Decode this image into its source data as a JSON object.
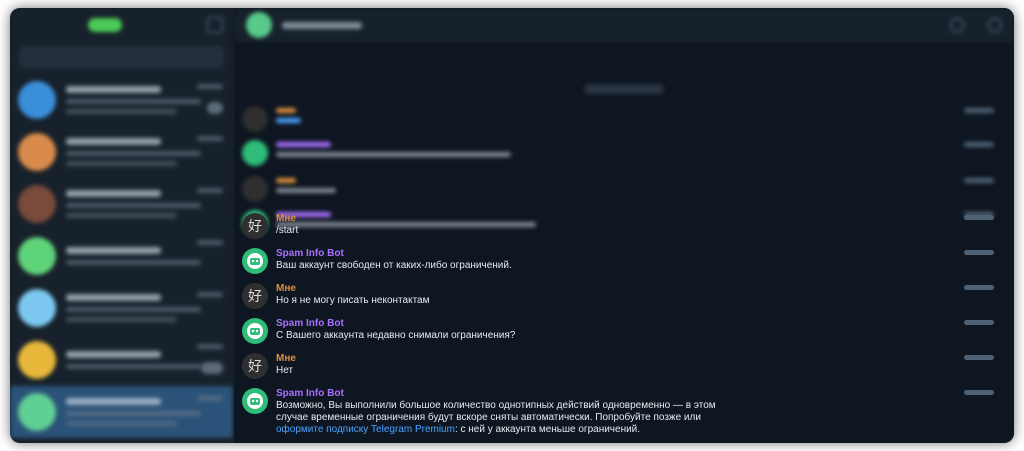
{
  "header": {
    "chat_name": "Spam Info Bot"
  },
  "messages": [
    {
      "sender": "Мне",
      "sender_role": "user",
      "text": "/start"
    },
    {
      "sender": "Spam Info Bot",
      "sender_role": "bot",
      "text": "Ваш аккаунт свободен от каких-либо ограничений."
    },
    {
      "sender": "Мне",
      "sender_role": "user",
      "text": "Но я не могу писать неконтактам"
    },
    {
      "sender": "Spam Info Bot",
      "sender_role": "bot",
      "text": "С Вашего аккаунта недавно снимали ограничения?"
    },
    {
      "sender": "Мне",
      "sender_role": "user",
      "text": "Нет"
    },
    {
      "sender": "Spam Info Bot",
      "sender_role": "bot",
      "text_line1": "Возможно, Вы выполнили большое количество однотипных действий одновременно — в этом",
      "text_line2": "случае временные ограничения будут вскоре сняты автоматически. Попробуйте позже или",
      "link_text": "оформите подписку Telegram Premium",
      "text_after_link": ": с ней у аккаунта меньше ограничений."
    }
  ],
  "colors": {
    "window_bg": "#17212b",
    "chat_bg": "#0e1621",
    "active_chat": "#2b5278",
    "user_name": "#e0903c",
    "bot_name": "#a970ff",
    "link": "#4aa3ff"
  }
}
